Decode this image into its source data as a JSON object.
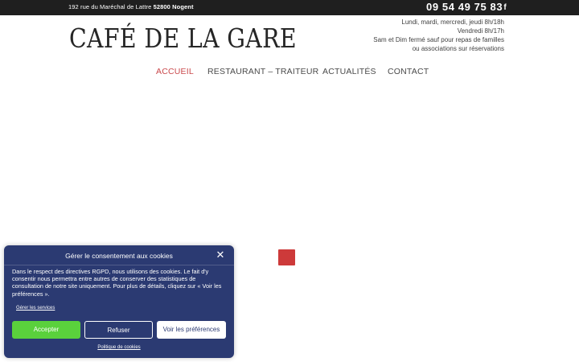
{
  "topbar": {
    "address": "192 rue du Maréchal de Lattre",
    "postcode_city": "52800 Nogent",
    "phone": "09 54 49 75 83",
    "facebook_glyph": "f",
    "facebook_icon": "facebook-icon"
  },
  "header": {
    "logo_text": "CAFÉ DE LA GARE",
    "hours": [
      "Lundi, mardi, mercredi, jeudi 8h/18h",
      "Vendredi 8h/17h",
      "Sam et Dim fermé sauf pour repas de familles",
      "ou associations sur réservations"
    ]
  },
  "nav": {
    "items": [
      {
        "label": "ACCUEIL",
        "active": true
      },
      {
        "label": "RESTAURANT – TRAITEUR",
        "active": false
      },
      {
        "label": "ACTUALITÉS",
        "active": false
      },
      {
        "label": "CONTACT",
        "active": false
      }
    ]
  },
  "cookie": {
    "title": "Gérer le consentement aux cookies",
    "close_glyph": "✕",
    "body": "Dans le respect des directives RGPD, nous utilisons des cookies. Le fait d'y consentir nous permettra entre autres de conserver des statistiques de consultation de notre site uniquement. Pour plus de détails, cliquez sur « Voir les préférences ».",
    "manage_services": "Gérer les services",
    "accept": "Accepter",
    "refuse": "Refuser",
    "preferences": "Voir les préférences",
    "policy": "Politique de cookies"
  },
  "colors": {
    "topbar_bg": "#1f1f1f",
    "nav_active": "#c9484b",
    "cookie_bg": "#2b3a72",
    "accept_btn": "#5ad13c",
    "accent_square": "#cd3a3a"
  }
}
